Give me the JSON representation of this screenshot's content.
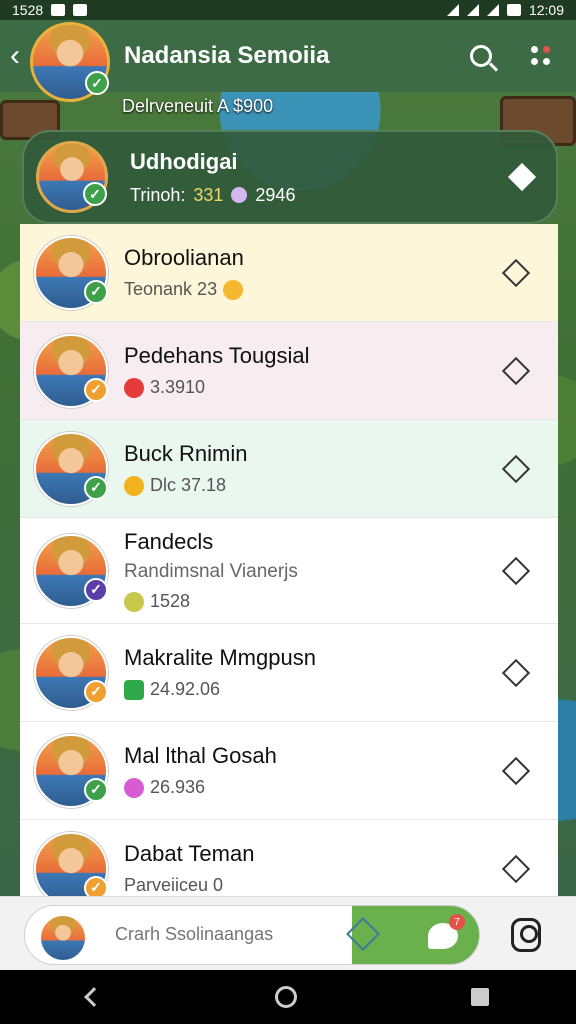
{
  "status_bar": {
    "time_left": "1528",
    "time_right": "12:09"
  },
  "header": {
    "title": "Nadansia Semoiia",
    "subtitle": "Delrveneuit A $900",
    "search_icon": "search-icon",
    "menu_icon": "more-icon"
  },
  "current_user": {
    "name": "Udhodigai",
    "stat_label": "Trinoh:",
    "stat_value": "331",
    "gem_value": "2946"
  },
  "contacts": [
    {
      "name": "Obroolianan",
      "sub": "Teonank 23",
      "chip_color": "#f5b82e",
      "badge": "green",
      "bg": "#fdf6d8"
    },
    {
      "name": "Pedehans Tougsial",
      "sub": "3.3910",
      "chip_color": "#e53b3b",
      "badge": "orange",
      "bg": "#f7ecef"
    },
    {
      "name": "Buck Rnimin",
      "sub": "Dlc 37.18",
      "chip_color": "#f2b21d",
      "badge": "green",
      "bg": "#e9f7ef"
    },
    {
      "name": "Fandecls",
      "desc": "Randimsnal Vianerjs",
      "sub": "1528",
      "chip_color": "#c8c84a",
      "badge": "purple",
      "bg": "#ffffff"
    },
    {
      "name": "Makralite Mmgpusn",
      "sub": "24.92.06",
      "chip_color": "#2fa84a",
      "badge": "orange",
      "bg": "#ffffff"
    },
    {
      "name": "Mal lthal Gosah",
      "sub": "26.936",
      "chip_color": "#d75bd1",
      "badge": "green",
      "bg": "#ffffff"
    },
    {
      "name": "Dabat Teman",
      "sub": "Parveiiceu 0",
      "chip_color": "#bbbbbb",
      "badge": "orange",
      "bg": "#ffffff"
    }
  ],
  "bottom_bar": {
    "search_placeholder": "Crarh Ssolinaangas",
    "chat_badge": "7"
  }
}
